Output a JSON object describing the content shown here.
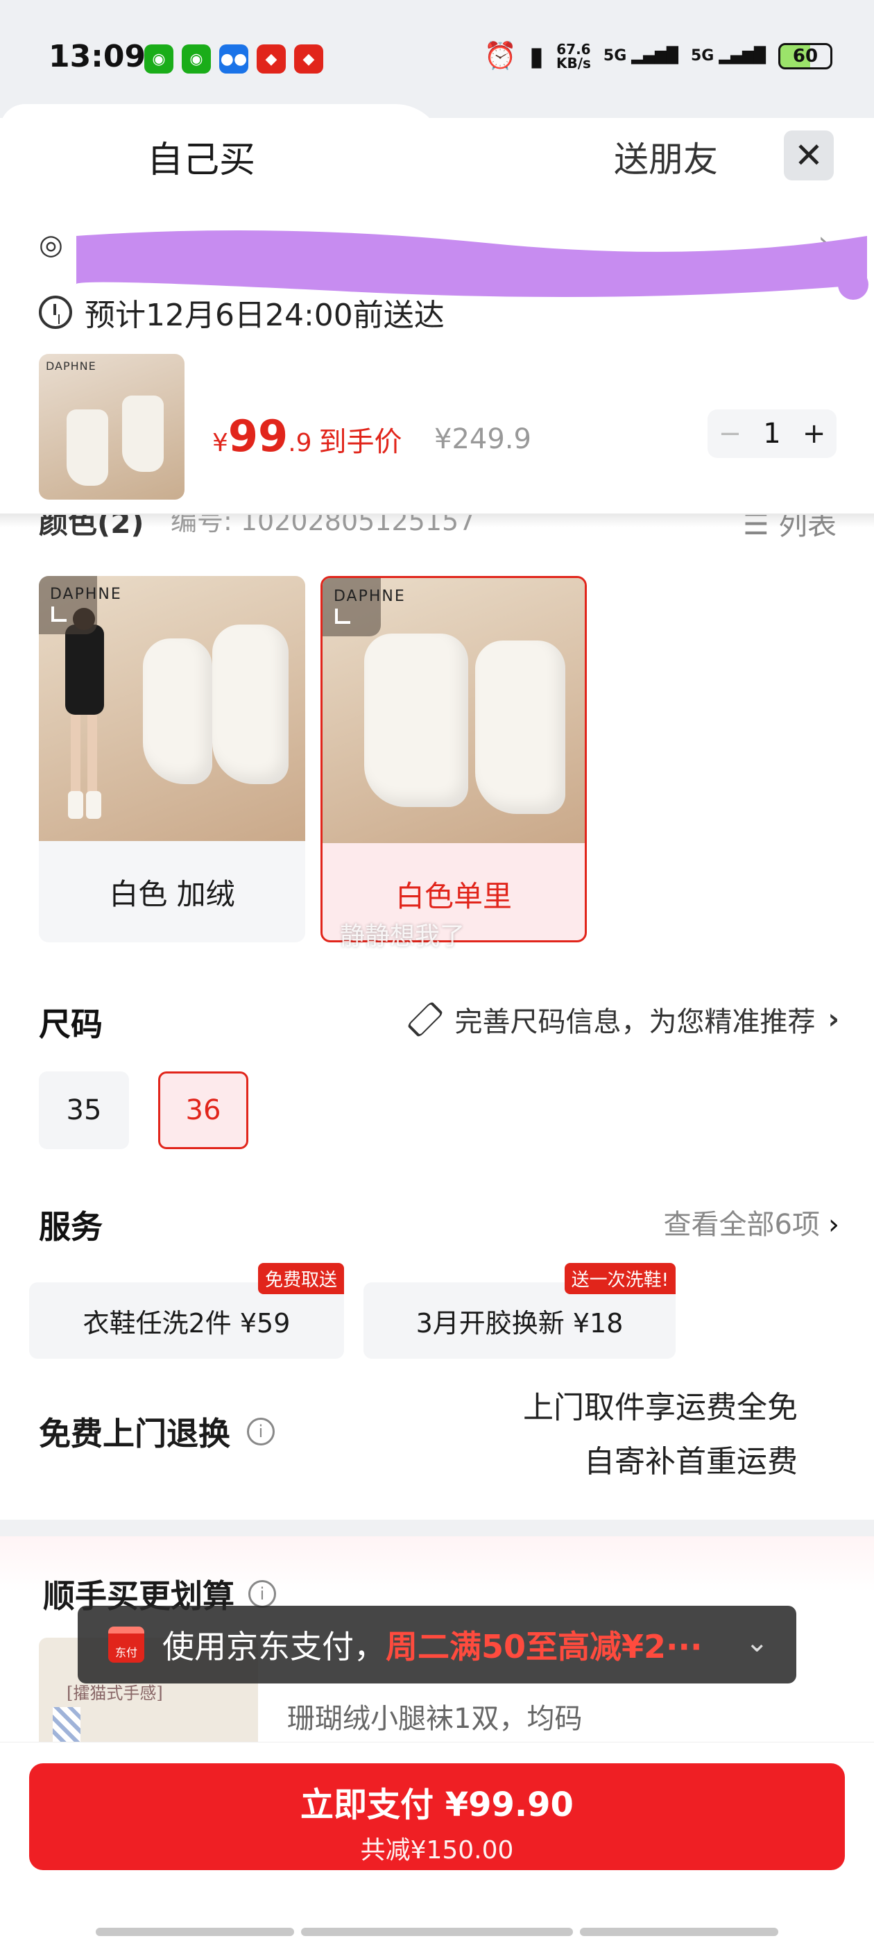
{
  "status_bar": {
    "time": "13:09",
    "net_speed": "67.6",
    "net_unit": "KB/s",
    "signal1": "5G",
    "signal2": "5G",
    "battery": "60"
  },
  "tabs": {
    "self": "自己买",
    "friend": "送朋友"
  },
  "address": {
    "tail": "...",
    "chevron": "›"
  },
  "delivery": {
    "text": "预计12月6日24:00前送达"
  },
  "product": {
    "thumb_brand": "DAPHNE",
    "currency": "¥",
    "price_int": "99",
    "price_dec": ".9",
    "price_label": "到手价",
    "original_price": "¥249.9",
    "qty_minus": "−",
    "qty": "1",
    "qty_plus": "+"
  },
  "color_section": {
    "title": "颜色(2)",
    "code": "编号: 10202805125157",
    "list_label": "列表"
  },
  "swatches": [
    {
      "brand": "DAPHNE",
      "name": "白色 加绒",
      "selected": false
    },
    {
      "brand": "DAPHNE",
      "name": "白色单里",
      "selected": true
    }
  ],
  "watermark": "静静想我了",
  "size_section": {
    "title": "尺码",
    "hint": "完善尺码信息，为您精准推荐",
    "chevron": "›",
    "sizes": [
      {
        "label": "35",
        "selected": false
      },
      {
        "label": "36",
        "selected": true
      }
    ]
  },
  "service_section": {
    "title": "服务",
    "see_all": "查看全部6项",
    "chevron": "›",
    "items": [
      {
        "label": "衣鞋任洗2件  ¥59",
        "tag": "免费取送"
      },
      {
        "label": "3月开胶换新  ¥18",
        "tag": "送一次洗鞋!"
      }
    ]
  },
  "return_section": {
    "title": "免费上门退换",
    "info": "i",
    "line1": "上门取件享运费全免",
    "line2": "自寄补首重运费"
  },
  "bundle": {
    "title": "顺手买更划算",
    "info": "i",
    "img_text": "[攉猫式手感]",
    "item": "珊瑚绒小腿袜1双，均码"
  },
  "toast": {
    "icon_text": "东付",
    "text": "使用京东支付，",
    "promo": "周二满50至高减¥2···",
    "chevron": "⌄"
  },
  "pay": {
    "main": "立即支付 ¥99.90",
    "sub": "共减¥150.00"
  },
  "colors": {
    "accent": "#e1251b",
    "pay_button": "#ef1f24",
    "scribble": "#c78cf0"
  }
}
